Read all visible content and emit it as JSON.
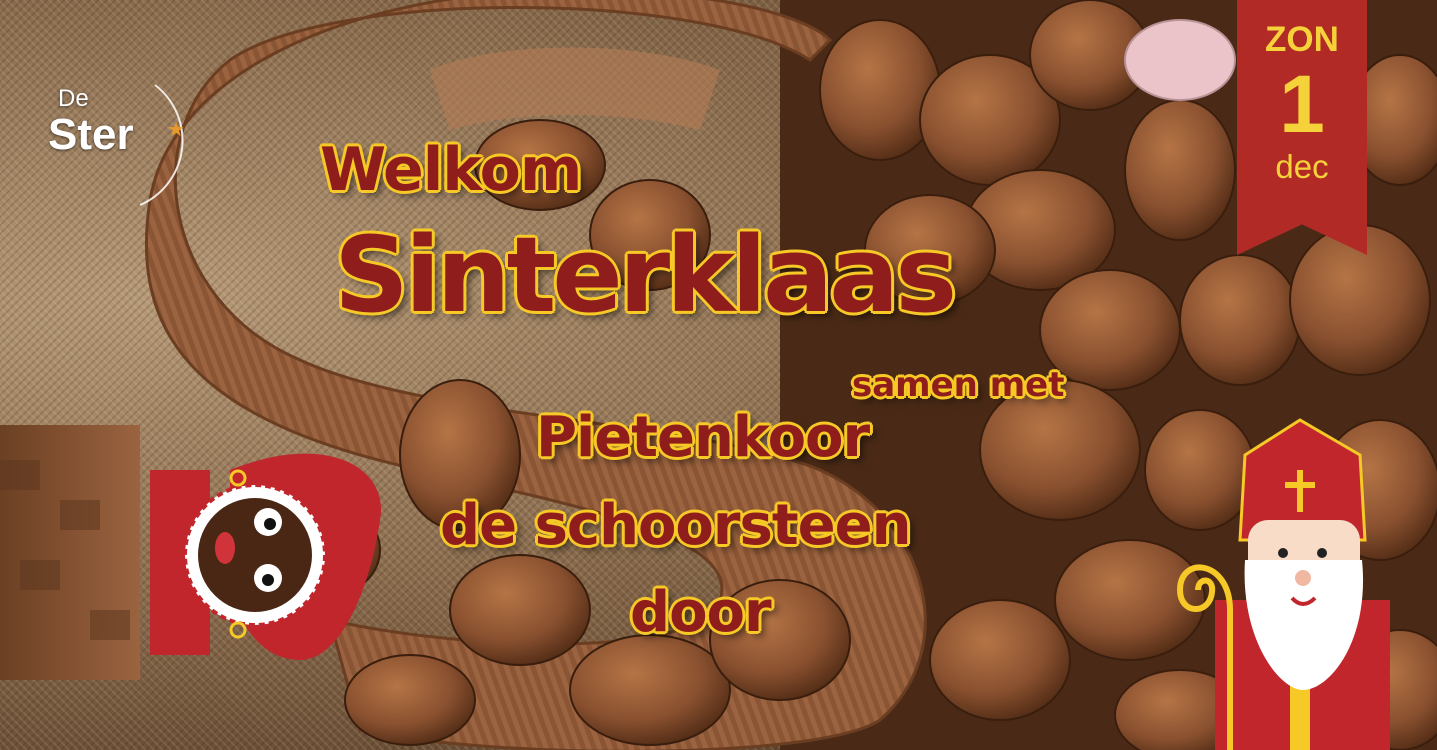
{
  "logo": {
    "line1": "De",
    "line2": "Ster",
    "star": "★"
  },
  "date_ribbon": {
    "weekday": "ZON",
    "day": "1",
    "month": "dec",
    "color": "#b12a26",
    "text_color": "#f6d23a"
  },
  "headline": {
    "line1": "Welkom",
    "line2": "Sinterklaas",
    "line3": "samen met",
    "line4": "Pietenkoor",
    "line5": "de schoorsteen",
    "line6": "door"
  },
  "colors": {
    "title_red": "#8f1d1b",
    "title_outline": "#f6c927",
    "chocolate": "#9b6340",
    "cookie": "#8a5130"
  },
  "illustrations": [
    "chocolate-letter-s",
    "pepernoten-cookies",
    "burlap-sack",
    "chimney-brick",
    "piet-character",
    "sinterklaas-character",
    "crosier-staff"
  ]
}
